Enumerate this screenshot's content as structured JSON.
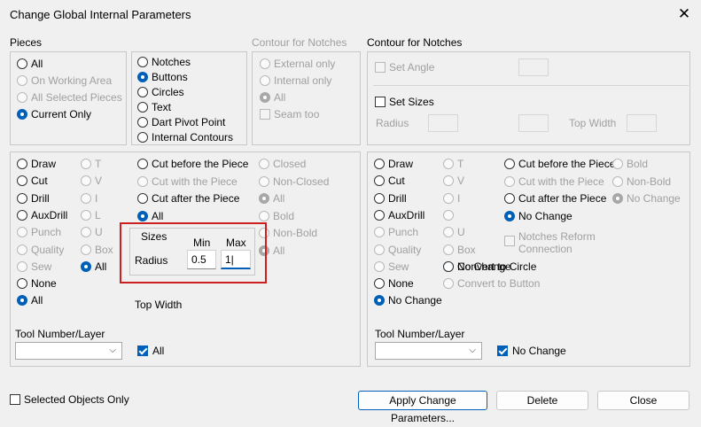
{
  "window": {
    "title": "Change Global Internal Parameters"
  },
  "pieces": {
    "title": "Pieces",
    "options": [
      {
        "label": "All",
        "enabled": true,
        "checked": false
      },
      {
        "label": "On Working Area",
        "enabled": false,
        "checked": false
      },
      {
        "label": "All Selected Pieces",
        "enabled": false,
        "checked": false
      },
      {
        "label": "Current Only",
        "enabled": true,
        "checked": true
      }
    ]
  },
  "notch_type": {
    "options": [
      {
        "label": "Notches",
        "checked": false
      },
      {
        "label": "Buttons",
        "checked": true
      },
      {
        "label": "Circles",
        "checked": false
      },
      {
        "label": "Text",
        "checked": false
      },
      {
        "label": "Dart Pivot Point",
        "checked": false
      },
      {
        "label": "Internal Contours",
        "checked": false
      }
    ]
  },
  "contour_left": {
    "title": "Contour for Notches",
    "external_only": "External only",
    "internal_only": "Internal only",
    "all": "All",
    "seam_too": "Seam too"
  },
  "contour_right": {
    "title": "Contour for Notches",
    "set_angle": "Set Angle",
    "set_sizes": "Set Sizes",
    "radius": "Radius",
    "top_width": "Top Width"
  },
  "left": {
    "col1": [
      {
        "label": "Draw",
        "enabled": true,
        "checked": false
      },
      {
        "label": "Cut",
        "enabled": true,
        "checked": false
      },
      {
        "label": "Drill",
        "enabled": true,
        "checked": false
      },
      {
        "label": "AuxDrill",
        "enabled": true,
        "checked": false
      },
      {
        "label": "Punch",
        "enabled": false,
        "checked": false
      },
      {
        "label": "Quality",
        "enabled": false,
        "checked": false
      },
      {
        "label": "Sew",
        "enabled": false,
        "checked": false
      },
      {
        "label": "None",
        "enabled": true,
        "checked": false
      },
      {
        "label": "All",
        "enabled": true,
        "checked": true
      }
    ],
    "col2": [
      {
        "label": "T",
        "enabled": false,
        "checked": false
      },
      {
        "label": "V",
        "enabled": false,
        "checked": false
      },
      {
        "label": "I",
        "enabled": false,
        "checked": false
      },
      {
        "label": "L",
        "enabled": false,
        "checked": false
      },
      {
        "label": "U",
        "enabled": false,
        "checked": false
      },
      {
        "label": "Box",
        "enabled": false,
        "checked": false
      },
      {
        "label": "All",
        "enabled": true,
        "checked": true
      }
    ],
    "col3": [
      {
        "label": "Cut before the Piece",
        "enabled": true,
        "checked": false
      },
      {
        "label": "Cut with the Piece",
        "enabled": false,
        "checked": false
      },
      {
        "label": "Cut after the Piece",
        "enabled": true,
        "checked": false
      },
      {
        "label": "All",
        "enabled": true,
        "checked": true
      }
    ],
    "col4": [
      {
        "label": "Closed",
        "enabled": false,
        "checked": false
      },
      {
        "label": "Non-Closed",
        "enabled": false,
        "checked": false
      },
      {
        "label": "All",
        "enabled": false,
        "checked": true
      },
      {
        "label": "Bold",
        "enabled": false,
        "checked": false
      },
      {
        "label": "Non-Bold",
        "enabled": false,
        "checked": false
      },
      {
        "label": "All",
        "enabled": false,
        "checked": true
      }
    ],
    "sizes": {
      "title": "Sizes",
      "min_label": "Min",
      "max_label": "Max",
      "radius_label": "Radius",
      "min_value": "0.5",
      "max_value": "1|"
    },
    "top_width": "Top Width",
    "tool": {
      "title": "Tool Number/Layer",
      "value": "",
      "all_label": "All"
    }
  },
  "right": {
    "col1": [
      {
        "label": "Draw",
        "enabled": true,
        "checked": false
      },
      {
        "label": "Cut",
        "enabled": true,
        "checked": false
      },
      {
        "label": "Drill",
        "enabled": true,
        "checked": false
      },
      {
        "label": "AuxDrill",
        "enabled": true,
        "checked": false
      },
      {
        "label": "Punch",
        "enabled": false,
        "checked": false
      },
      {
        "label": "Quality",
        "enabled": false,
        "checked": false
      },
      {
        "label": "Sew",
        "enabled": false,
        "checked": false
      },
      {
        "label": "None",
        "enabled": true,
        "checked": false
      },
      {
        "label": "No Change",
        "enabled": true,
        "checked": true
      }
    ],
    "col2": [
      {
        "label": "T",
        "enabled": false,
        "checked": false
      },
      {
        "label": "V",
        "enabled": false,
        "checked": false
      },
      {
        "label": "I",
        "enabled": false,
        "checked": false
      },
      {
        "label": "",
        "enabled": false,
        "checked": false
      },
      {
        "label": "U",
        "enabled": false,
        "checked": false
      },
      {
        "label": "Box",
        "enabled": false,
        "checked": false
      },
      {
        "label": "No Change",
        "enabled": true,
        "checked": true
      }
    ],
    "col3": [
      {
        "label": "Cut before the Piece",
        "enabled": true,
        "checked": false
      },
      {
        "label": "Cut with the Piece",
        "enabled": false,
        "checked": false
      },
      {
        "label": "Cut after the Piece",
        "enabled": true,
        "checked": false
      },
      {
        "label": "No Change",
        "enabled": true,
        "checked": true
      }
    ],
    "col4": [
      {
        "label": "Bold",
        "enabled": false,
        "checked": false
      },
      {
        "label": "Non-Bold",
        "enabled": false,
        "checked": false
      },
      {
        "label": "No Change",
        "enabled": false,
        "checked": true
      }
    ],
    "notches_reform": "Notches Reform Connection",
    "convert_circle": "Convert to Circle",
    "convert_button": "Convert to Button",
    "tool": {
      "title": "Tool Number/Layer",
      "value": "",
      "no_change_label": "No Change"
    }
  },
  "footer": {
    "selected_only": "Selected Objects Only",
    "apply": "Apply Change Parameters...",
    "delete": "Delete",
    "close": "Close"
  }
}
